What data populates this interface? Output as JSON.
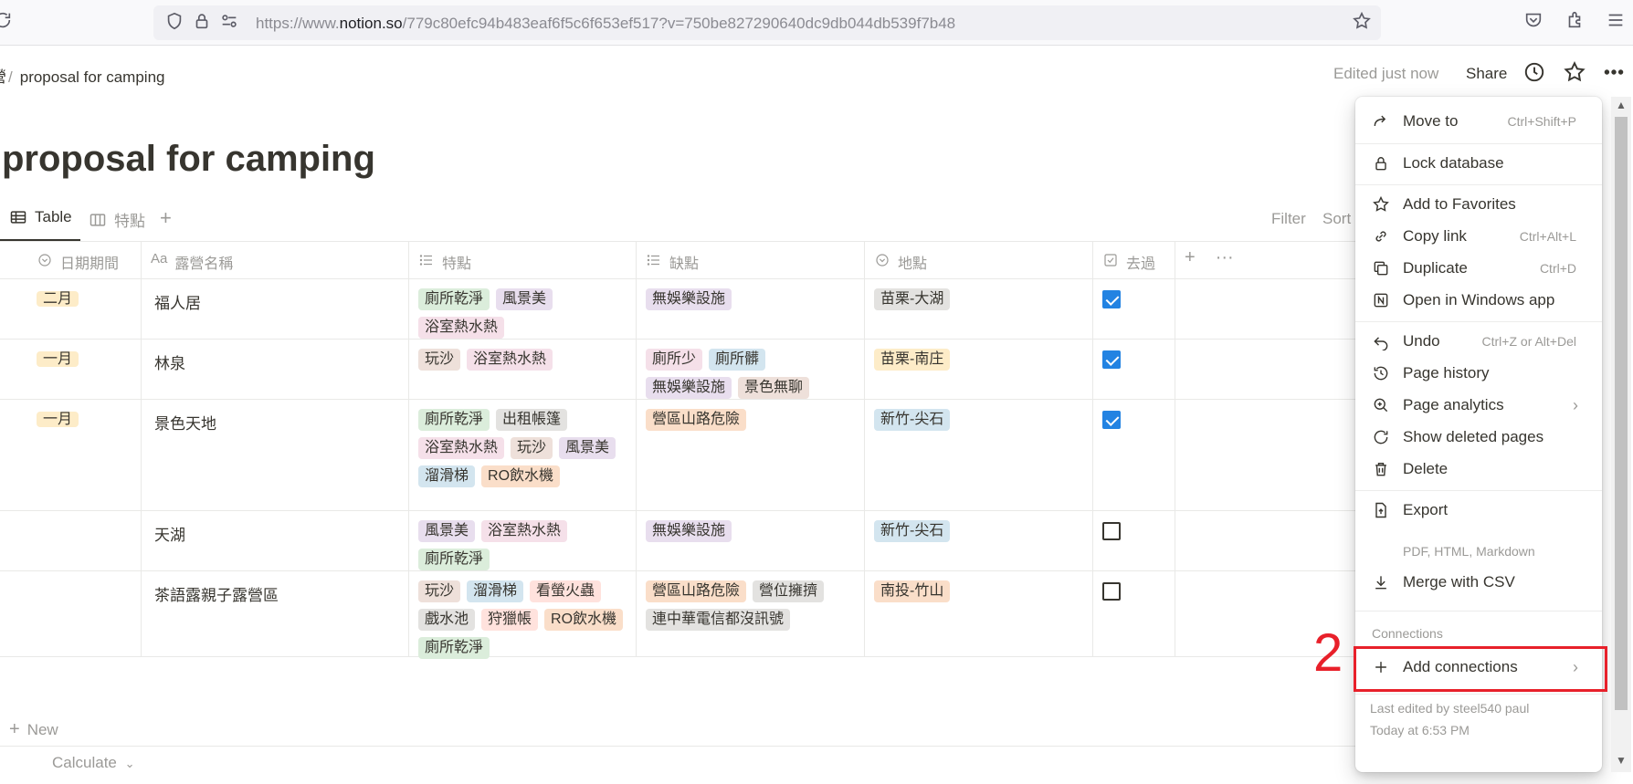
{
  "browser": {
    "url_prefix": "https://www.",
    "url_domain": "notion.so",
    "url_path": "/779c80efc94b483eaf6f5c6f653ef517?v=750be827290640dc9db044db539f7b48"
  },
  "topbar": {
    "breadcrumb_fragment": "營",
    "breadcrumb_sep": "/",
    "breadcrumb_page": "proposal for camping",
    "edited": "Edited just now",
    "share": "Share"
  },
  "page": {
    "title": "proposal for camping"
  },
  "views": {
    "table_label": "Table",
    "board_label": "特點",
    "add": "+",
    "filter": "Filter",
    "sort": "Sort"
  },
  "table": {
    "headers": {
      "date": "日期期間",
      "name_prefix": "Aa",
      "name": "露營名稱",
      "features": "特點",
      "cons": "缺點",
      "location": "地點",
      "visited": "去過",
      "add": "+",
      "more": "···"
    },
    "rows": [
      {
        "date": "二月",
        "name": "福人居",
        "features": [
          {
            "text": "廁所乾淨",
            "color": "green"
          },
          {
            "text": "風景美",
            "color": "purple"
          },
          {
            "text": "浴室熱水熱",
            "color": "pink"
          }
        ],
        "cons": [
          {
            "text": "無娛樂設施",
            "color": "purple"
          }
        ],
        "location": [
          {
            "text": "苗栗-大湖",
            "color": "gray"
          }
        ],
        "visited": true
      },
      {
        "date": "一月",
        "name": "林泉",
        "features": [
          {
            "text": "玩沙",
            "color": "brown"
          },
          {
            "text": "浴室熱水熱",
            "color": "pink"
          }
        ],
        "cons": [
          {
            "text": "廁所少",
            "color": "pink"
          },
          {
            "text": "廁所髒",
            "color": "blue"
          },
          {
            "text": "無娛樂設施",
            "color": "purple"
          },
          {
            "text": "景色無聊",
            "color": "brown"
          }
        ],
        "location": [
          {
            "text": "苗栗-南庄",
            "color": "yellow"
          }
        ],
        "visited": true
      },
      {
        "date": "一月",
        "name": "景色天地",
        "features": [
          {
            "text": "廁所乾淨",
            "color": "green"
          },
          {
            "text": "出租帳篷",
            "color": "gray"
          },
          {
            "text": "浴室熱水熱",
            "color": "pink"
          },
          {
            "text": "玩沙",
            "color": "brown"
          },
          {
            "text": "風景美",
            "color": "purple"
          },
          {
            "text": "溜滑梯",
            "color": "blue"
          },
          {
            "text": "RO飲水機",
            "color": "orange"
          }
        ],
        "cons": [
          {
            "text": "營區山路危險",
            "color": "orange"
          }
        ],
        "location": [
          {
            "text": "新竹-尖石",
            "color": "blue"
          }
        ],
        "visited": true
      },
      {
        "date": "",
        "name": "天湖",
        "features": [
          {
            "text": "風景美",
            "color": "purple"
          },
          {
            "text": "浴室熱水熱",
            "color": "pink"
          },
          {
            "text": "廁所乾淨",
            "color": "green"
          }
        ],
        "cons": [
          {
            "text": "無娛樂設施",
            "color": "purple"
          }
        ],
        "location": [
          {
            "text": "新竹-尖石",
            "color": "blue"
          }
        ],
        "visited": false
      },
      {
        "date": "",
        "name": "茶語露親子露營區",
        "features": [
          {
            "text": "玩沙",
            "color": "brown"
          },
          {
            "text": "溜滑梯",
            "color": "blue"
          },
          {
            "text": "看螢火蟲",
            "color": "red"
          },
          {
            "text": "戲水池",
            "color": "gray"
          },
          {
            "text": "狩獵帳",
            "color": "red"
          },
          {
            "text": "RO飲水機",
            "color": "orange"
          },
          {
            "text": "廁所乾淨",
            "color": "green"
          }
        ],
        "cons": [
          {
            "text": "營區山路危險",
            "color": "orange"
          },
          {
            "text": "營位擁擠",
            "color": "gray"
          },
          {
            "text": "連中華電信都沒訊號",
            "color": "gray"
          }
        ],
        "location": [
          {
            "text": "南投-竹山",
            "color": "orange"
          }
        ],
        "visited": false
      }
    ],
    "new_label": "New",
    "calculate_label": "Calculate"
  },
  "menu": {
    "move_to": {
      "label": "Move to",
      "shortcut": "Ctrl+Shift+P"
    },
    "lock": {
      "label": "Lock database"
    },
    "favorites": {
      "label": "Add to Favorites"
    },
    "copy_link": {
      "label": "Copy link",
      "shortcut": "Ctrl+Alt+L"
    },
    "duplicate": {
      "label": "Duplicate",
      "shortcut": "Ctrl+D"
    },
    "open_windows": {
      "label": "Open in Windows app"
    },
    "undo": {
      "label": "Undo",
      "shortcut": "Ctrl+Z or Alt+Del"
    },
    "history": {
      "label": "Page history"
    },
    "analytics": {
      "label": "Page analytics"
    },
    "deleted": {
      "label": "Show deleted pages"
    },
    "delete": {
      "label": "Delete"
    },
    "export": {
      "label": "Export",
      "sub": "PDF, HTML, Markdown"
    },
    "merge_csv": {
      "label": "Merge with CSV"
    },
    "connections_header": "Connections",
    "add_connections": {
      "label": "Add connections"
    },
    "last_edited_by": "Last edited by steel540 paul",
    "last_edited_time": "Today at 6:53 PM"
  },
  "annotation": {
    "step": "2",
    "color": "#e8202a"
  }
}
